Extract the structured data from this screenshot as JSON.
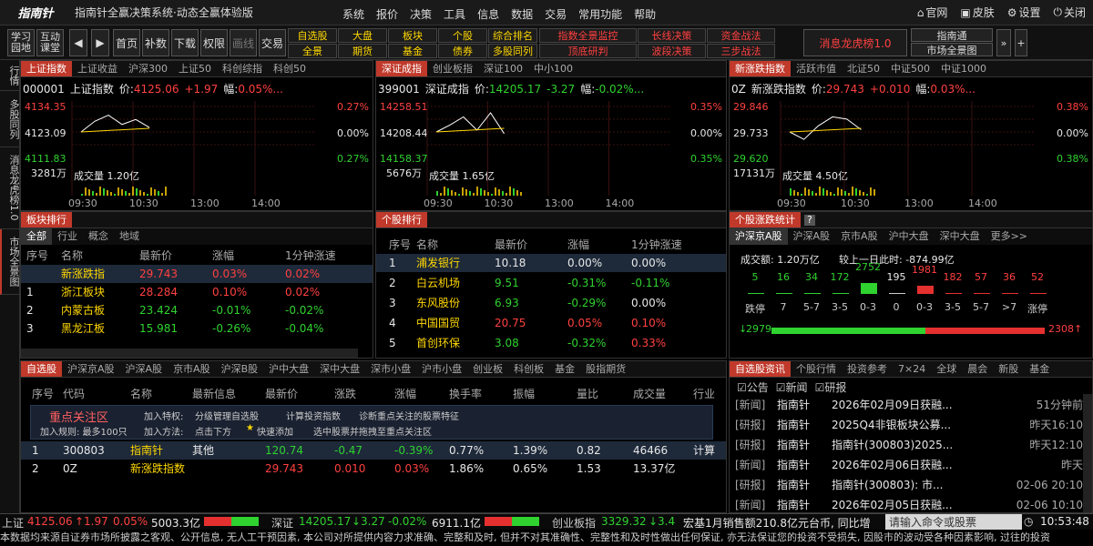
{
  "app": {
    "logo": "指南针",
    "title": "指南针全赢决策系统·动态全赢体验版",
    "menu": [
      "系统",
      "报价",
      "决策",
      "工具",
      "信息",
      "数据",
      "交易",
      "常用功能",
      "帮助"
    ],
    "win": [
      "官网",
      "皮肤",
      "设置",
      "关闭"
    ]
  },
  "toolbar": {
    "left": [
      "学习\n园地",
      "互动\n课堂"
    ],
    "btns": [
      "首页",
      "补数",
      "下载",
      "权限",
      "画线",
      "交易"
    ],
    "grid1": [
      "自选股",
      "大盘",
      "板块",
      "个股",
      "综合排名",
      "全景",
      "期货",
      "基金",
      "债券",
      "多股同列"
    ],
    "grid2": [
      "指数全景监控",
      "长线决策",
      "资金战法",
      "顶底研判",
      "波段决策",
      "三步战法"
    ],
    "msg": "消息龙虎榜1.0",
    "hkbtn": "指南通",
    "mkbtn": "市场全景图"
  },
  "rail": [
    "行情",
    "多股同列",
    "消息龙虎榜1.0",
    "市场全景图"
  ],
  "charts": [
    {
      "tabs": [
        "上证指数",
        "上证收益",
        "沪深300",
        "上证50",
        "科创综指",
        "科创50"
      ],
      "code": "000001",
      "name": "上证指数",
      "price": "4125.06",
      "chg": "+1.97",
      "pct": "0.05%...",
      "hi": "4134.35",
      "mid": "4123.09",
      "lo": "4111.83",
      "phi": "0.27%",
      "pmid": "0.00%",
      "plo": "0.27%",
      "vol": "3281万",
      "volfull": "成交量 1.20亿",
      "times": [
        "09:30",
        "10:30",
        "13:00",
        "14:00"
      ]
    },
    {
      "tabs": [
        "深证成指",
        "创业板指",
        "深证100",
        "中小100"
      ],
      "code": "399001",
      "name": "深证成指",
      "price": "14205.17",
      "chg": "-3.27",
      "pct": "-0.02%...",
      "hi": "14258.51",
      "mid": "14208.44",
      "lo": "14158.37",
      "phi": "0.35%",
      "pmid": "0.00%",
      "plo": "0.35%",
      "vol": "5676万",
      "volfull": "成交量 1.65亿",
      "times": [
        "09:30",
        "10:30",
        "13:00",
        "14:00"
      ]
    },
    {
      "tabs": [
        "新涨跌指数",
        "活跃市值",
        "北证50",
        "中证500",
        "中证1000"
      ],
      "code": "0Z",
      "name": "新涨跌指数",
      "price": "29.743",
      "chg": "+0.010",
      "pct": "0.03%...",
      "hi": "29.846",
      "mid": "29.733",
      "lo": "29.620",
      "phi": "0.38%",
      "pmid": "0.00%",
      "plo": "0.38%",
      "vol": "17131万",
      "volfull": "成交量 4.50亿",
      "times": [
        "09:30",
        "10:30",
        "13:00",
        "14:00"
      ]
    }
  ],
  "chart_data": [
    {
      "type": "line",
      "title": "上证指数",
      "x": [
        "09:30",
        "10:30"
      ],
      "series": [
        {
          "values": [
            4123.09,
            4127.8,
            4130.5,
            4126.4,
            4128.6,
            4125.06
          ]
        }
      ],
      "ylim": [
        4111.83,
        4134.35
      ]
    },
    {
      "type": "line",
      "title": "深证成指",
      "x": [
        "09:30",
        "10:30"
      ],
      "series": [
        {
          "values": [
            14208.44,
            14222,
            14238,
            14212,
            14246,
            14205.17
          ]
        }
      ],
      "ylim": [
        14158.37,
        14258.51
      ]
    },
    {
      "type": "line",
      "title": "新涨跌指数",
      "x": [
        "09:30",
        "10:30"
      ],
      "series": [
        {
          "values": [
            29.733,
            29.7,
            29.76,
            29.8,
            29.79,
            29.743
          ]
        }
      ],
      "ylim": [
        29.62,
        29.846
      ]
    }
  ],
  "sector": {
    "title": "板块排行",
    "tabs": [
      "全部",
      "行业",
      "概念",
      "地域"
    ],
    "cols": [
      "序号",
      "名称",
      "最新价",
      "涨幅",
      "1分钟涨速"
    ],
    "rows": [
      [
        "",
        "新涨跌指",
        "29.743",
        "0.03%",
        "0.02%"
      ],
      [
        "1",
        "浙江板块",
        "28.284",
        "0.10%",
        "0.02%"
      ],
      [
        "2",
        "内蒙古板",
        "23.424",
        "-0.01%",
        "-0.02%"
      ],
      [
        "3",
        "黑龙江板",
        "15.981",
        "-0.26%",
        "-0.04%"
      ]
    ]
  },
  "stockrank": {
    "title": "个股排行",
    "cols": [
      "序号",
      "名称",
      "最新价",
      "涨幅",
      "1分钟涨速"
    ],
    "rows": [
      [
        "1",
        "浦发银行",
        "10.18",
        "0.00%",
        "0.00%"
      ],
      [
        "2",
        "白云机场",
        "9.51",
        "-0.31%",
        "-0.11%"
      ],
      [
        "3",
        "东风股份",
        "6.93",
        "-0.29%",
        "0.00%"
      ],
      [
        "4",
        "中国国贸",
        "20.75",
        "0.05%",
        "0.10%"
      ],
      [
        "5",
        "首创环保",
        "3.08",
        "-0.32%",
        "0.33%"
      ]
    ]
  },
  "updown": {
    "title": "个股涨跌统计",
    "tabs": [
      "沪深京A股",
      "沪深A股",
      "京市A股",
      "沪中大盘",
      "深中大盘",
      "更多>>"
    ],
    "amount": "成交额: 1.20万亿",
    "compare": "较上一日此时: -874.99亿",
    "counts": [
      "5",
      "16",
      "34",
      "172",
      "2752",
      "195",
      "1981",
      "182",
      "57",
      "36",
      "52"
    ],
    "labels": [
      "跌停",
      "7",
      "5-7",
      "3-5",
      "0-3",
      "0",
      "0-3",
      "3-5",
      "5-7",
      ">7",
      "涨停"
    ],
    "down": "2979",
    "up": "2308"
  },
  "watch": {
    "tabs": [
      "自选股",
      "沪深京A股",
      "沪深A股",
      "京市A股",
      "沪深B股",
      "沪中大盘",
      "深中大盘",
      "深市小盘",
      "沪市小盘",
      "创业板",
      "科创板",
      "基金",
      "股指期货"
    ],
    "cols": [
      "序号",
      "代码",
      "名称",
      "最新信息",
      "最新价",
      "涨跌",
      "涨幅",
      "换手率",
      "振幅",
      "量比",
      "成交量",
      "行业"
    ],
    "focus": {
      "title": "重点关注区",
      "rule": "加入规则: 最多100只",
      "l1": "加入特权:",
      "l2": "加入方法:",
      "f1": "分级管理自选股",
      "f2": "计算投资指数",
      "f3": "诊断重点关注的股票特征",
      "f4": "点击下方",
      "f5": "快速添加",
      "f6": "选中股票并拖拽至重点关注区"
    },
    "rows": [
      [
        "1",
        "300803",
        "指南针",
        "其他",
        "120.74",
        "-0.47",
        "-0.39%",
        "0.77%",
        "1.39%",
        "0.82",
        "46466",
        "计算"
      ],
      [
        "2",
        "0Z",
        "新涨跌指数",
        "",
        "29.743",
        "0.010",
        "0.03%",
        "1.86%",
        "0.65%",
        "1.53",
        "13.37亿",
        ""
      ]
    ]
  },
  "news": {
    "tabs": [
      "自选股资讯",
      "个股行情",
      "投资参考",
      "7×24",
      "全球",
      "晨会",
      "新股",
      "基金"
    ],
    "checks": [
      "公告",
      "新闻",
      "研报"
    ],
    "rows": [
      [
        "[新闻]",
        "指南针",
        "2026年02月09日获融...",
        "51分钟前"
      ],
      [
        "[研报]",
        "指南针",
        "2025Q4非银板块公募...",
        "昨天16:10"
      ],
      [
        "[研报]",
        "指南针",
        "指南针(300803)2025...",
        "昨天12:10"
      ],
      [
        "[新闻]",
        "指南针",
        "2026年02月06日获融...",
        "昨天"
      ],
      [
        "[研报]",
        "指南针",
        "指南针(300803): 市...",
        "02-06 20:10"
      ],
      [
        "[新闻]",
        "指南针",
        "2026年02月05日获融...",
        "02-06 10:10"
      ]
    ]
  },
  "status": {
    "sh": "上证",
    "shv": "4125.06",
    "shc": "1.97",
    "shp": "0.05%",
    "sha": "5003.3亿",
    "sz": "深证",
    "szv": "14205.17",
    "szc": "3.27",
    "szp": "-0.02%",
    "sza": "6911.1亿",
    "cy": "创业板指",
    "cyv": "3329.32",
    "cyc": "3.4",
    "ticker": "宏基1月销售额210.8亿元台币, 同比增",
    "cmd": "请输入命令或股票",
    "time": "10:53:48"
  },
  "disclaimer": "本数据均来源自证券市场所披露之客观、公开信息, 无人工干预因素, 本公司对所提供内容力求准确、完整和及时, 但并不对其准确性、完整性和及时性做出任何保证, 亦无法保证您的投资不受损失, 因股市的波动受各种因素影响, 过往的投资"
}
